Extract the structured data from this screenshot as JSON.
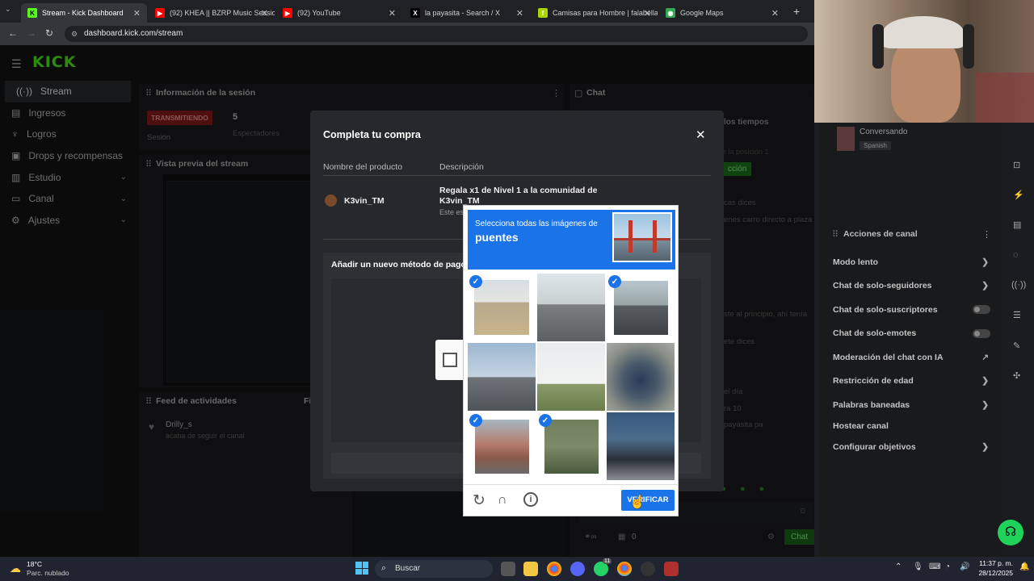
{
  "browser": {
    "tabs": [
      {
        "title": "Stream - Kick Dashboard",
        "icon_color": "#53fc18",
        "icon_text": "K"
      },
      {
        "title": "(92) KHEA || BZRP Music Session",
        "icon_color": "#ff0000",
        "icon_text": "▶"
      },
      {
        "title": "(92) YouTube",
        "icon_color": "#ff0000",
        "icon_text": "▶"
      },
      {
        "title": "la payasita - Search / X",
        "icon_color": "#000000",
        "icon_text": "X"
      },
      {
        "title": "Camisas para Hombre | falabella",
        "icon_color": "#aad500",
        "icon_text": "f"
      },
      {
        "title": "Google Maps",
        "icon_color": "#34a853",
        "icon_text": "◉"
      }
    ],
    "url": "dashboard.kick.com/stream"
  },
  "kick": {
    "logo": "KICK",
    "sidebar": [
      {
        "label": "Stream",
        "icon": "broadcast-icon",
        "active": true
      },
      {
        "label": "Ingresos",
        "icon": "money-icon"
      },
      {
        "label": "Logros",
        "icon": "trophy-icon"
      },
      {
        "label": "Drops y recompensas",
        "icon": "gift-icon"
      },
      {
        "label": "Estudio",
        "icon": "studio-icon",
        "chevron": true
      },
      {
        "label": "Canal",
        "icon": "channel-icon",
        "chevron": true
      },
      {
        "label": "Ajustes",
        "icon": "settings-icon",
        "chevron": true
      }
    ],
    "session": {
      "title": "Información de la sesión",
      "status": "TRANSMITIENDO",
      "status_sub": "Sesión",
      "viewers": "5",
      "viewers_label": "Espectadores"
    },
    "preview_title": "Vista previa del stream",
    "feed": {
      "title": "Feed de actividades",
      "tab2": "Fi",
      "user": "Drilly_s",
      "action": "acaba de seguir el canal"
    },
    "chat": {
      "title": "Chat",
      "fragments": [
        "los tiempos",
        "r la posición 1",
        "cción",
        "cas dices",
        "enes carro directo a plaza",
        "ste al principio, ahí tenía",
        "ete dices",
        "el día",
        "ra 10",
        "payasita pa"
      ],
      "count": "0",
      "send_label": "Chat"
    }
  },
  "modal": {
    "title": "Completa tu compra",
    "col_product": "Nombre del producto",
    "col_desc": "Descripción",
    "product_name": "K3vin_TM",
    "desc_line1": "Regala x1 de Nivel 1 a la comunidad de",
    "desc_line2": "K3vin_TM",
    "desc_small": "Este es",
    "payment_title": "Añadir un nuevo método de pago"
  },
  "captcha": {
    "instruction": "Selecciona todas las imágenes de",
    "keyword": "puentes",
    "verify_label": "VERIFICAR",
    "tiles_selected": [
      true,
      false,
      true,
      false,
      false,
      false,
      true,
      true,
      false
    ]
  },
  "right": {
    "category_label": "Conversando",
    "language_tag": "Spanish",
    "actions_title": "Acciones de canal",
    "actions": [
      {
        "label": "Modo lento",
        "type": "chevron"
      },
      {
        "label": "Chat de solo-seguidores",
        "type": "chevron"
      },
      {
        "label": "Chat de solo-suscriptores",
        "type": "toggle"
      },
      {
        "label": "Chat de solo-emotes",
        "type": "toggle"
      },
      {
        "label": "Moderación del chat con IA",
        "type": "external"
      },
      {
        "label": "Restricción de edad",
        "type": "chevron"
      },
      {
        "label": "Palabras baneadas",
        "type": "chevron"
      },
      {
        "label": "Hostear canal",
        "type": "none"
      },
      {
        "label": "Configurar objetivos",
        "type": "chevron"
      }
    ]
  },
  "taskbar": {
    "temp": "18°C",
    "weather": "Parc. nublado",
    "search_placeholder": "Buscar",
    "time": "11:37 p. m.",
    "date": "28/12/2025",
    "discord_badge": "11"
  }
}
